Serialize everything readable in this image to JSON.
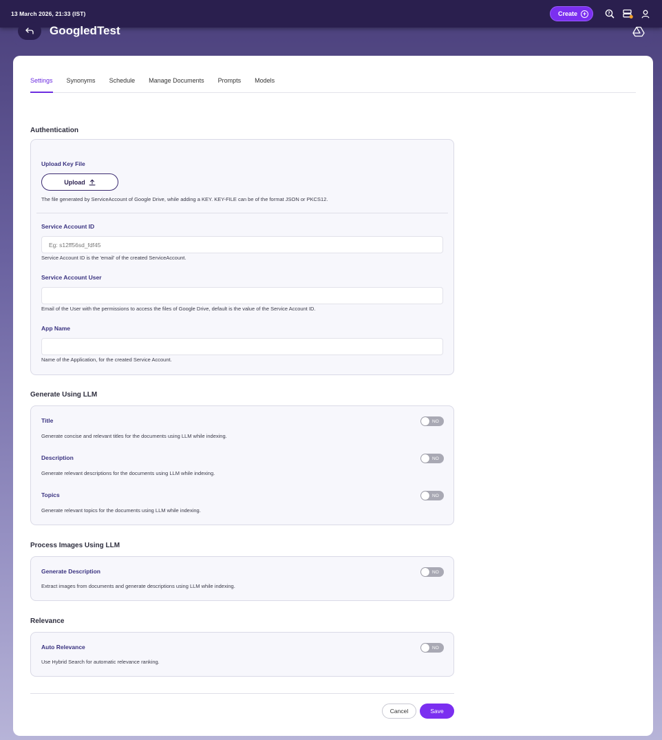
{
  "topbar": {
    "datetime": "13 March 2026, 21:33 (IST)",
    "create_label": "Create",
    "icons": [
      "plus-circle-icon",
      "help-icon",
      "storage-icon",
      "user-icon"
    ]
  },
  "header": {
    "title": "GoogledTest",
    "back_icon": "back-arrow-icon",
    "drive_icon": "google-drive-icon"
  },
  "tabs": [
    {
      "label": "Settings",
      "active": true
    },
    {
      "label": "Synonyms",
      "active": false
    },
    {
      "label": "Schedule",
      "active": false
    },
    {
      "label": "Manage Documents",
      "active": false
    },
    {
      "label": "Prompts",
      "active": false
    },
    {
      "label": "Models",
      "active": false
    }
  ],
  "authentication": {
    "title": "Authentication",
    "upload": {
      "label": "Upload Key File",
      "button": "Upload",
      "help": "The file generated by ServiceAccount of Google Drive, while adding a KEY. KEY-FILE can be of the format JSON or PKCS12."
    },
    "service_account_id": {
      "label": "Service Account ID",
      "placeholder": "Eg: s12ff56sd_fdf45",
      "value": "",
      "help": "Service Account ID is the 'email' of the created ServiceAccount."
    },
    "service_account_user": {
      "label": "Service Account User",
      "value": "",
      "help": "Email of the User with the permissions to access the files of Google Drive, default is the value of the Service Account ID."
    },
    "app_name": {
      "label": "App Name",
      "value": "",
      "help": "Name of the Application, for the created Service Account."
    }
  },
  "generate_llm": {
    "title": "Generate Using LLM",
    "items": [
      {
        "label": "Title",
        "help": "Generate concise and relevant titles for the documents using LLM while indexing.",
        "toggle": "NO"
      },
      {
        "label": "Description",
        "help": "Generate relevant descriptions for the documents using LLM while indexing.",
        "toggle": "NO"
      },
      {
        "label": "Topics",
        "help": "Generate relevant topics for the documents using LLM while indexing.",
        "toggle": "NO"
      }
    ]
  },
  "process_images": {
    "title": "Process Images Using LLM",
    "items": [
      {
        "label": "Generate Description",
        "help": "Extract images from documents and generate descriptions using LLM while indexing.",
        "toggle": "NO"
      }
    ]
  },
  "relevance": {
    "title": "Relevance",
    "items": [
      {
        "label": "Auto Relevance",
        "help": "Use Hybrid Search for automatic relevance ranking.",
        "toggle": "NO"
      }
    ]
  },
  "footer": {
    "cancel": "Cancel",
    "save": "Save"
  },
  "colors": {
    "accent": "#7b2ff0",
    "topbar": "#2a1f4e",
    "label": "#3a3380"
  }
}
